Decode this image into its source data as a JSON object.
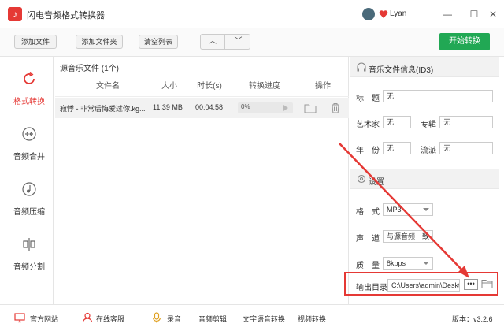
{
  "window": {
    "title": "闪电音频格式转换器",
    "user": "Lyan",
    "minimize": "—",
    "maximize": "☐",
    "close": "✕"
  },
  "toolbar": {
    "add_file": "添加文件",
    "add_folder": "添加文件夹",
    "clear_list": "清空列表",
    "up": "︿",
    "down": "﹀",
    "start": "开始转换"
  },
  "sidebar": {
    "items": [
      {
        "label": "格式转换",
        "icon": "refresh-icon",
        "active": true
      },
      {
        "label": "音频合并",
        "icon": "merge-icon",
        "active": false
      },
      {
        "label": "音频压缩",
        "icon": "compress-icon",
        "active": false
      },
      {
        "label": "音频分割",
        "icon": "split-icon",
        "active": false
      }
    ]
  },
  "file_list": {
    "title": "源音乐文件 (1个)",
    "columns": [
      "文件名",
      "大小",
      "时长(s)",
      "转换进度",
      "操作"
    ],
    "rows": [
      {
        "name": "寂悸 - 非常后悔爱过你.kg...",
        "size": "11.39 MB",
        "duration": "00:04:58",
        "progress": "0%"
      }
    ]
  },
  "id3": {
    "title": "音乐文件信息(ID3)",
    "title_label": "标　题",
    "title_value": "无",
    "artist_label": "艺术家",
    "artist_value": "无",
    "album_label": "专辑",
    "album_value": "无",
    "year_label": "年　份",
    "year_value": "无",
    "genre_label": "流派",
    "genre_value": "无"
  },
  "settings": {
    "title": "设置",
    "format_label": "格　式",
    "format_value": "MP3",
    "channel_label": "声　道",
    "channel_value": "与源音频一致",
    "quality_label": "质　量",
    "quality_value": "8kbps",
    "output_label": "输出目录",
    "output_value": "C:\\Users\\admin\\Desktc",
    "browse": "•••"
  },
  "footer": {
    "website": "官方网站",
    "support": "在线客服",
    "record": "录音",
    "edit": "音频剪辑",
    "tts": "文字语音转换",
    "video": "视频转换",
    "version": "版本：v3.2.6"
  },
  "colors": {
    "accent": "#e53935",
    "start": "#21a854"
  }
}
